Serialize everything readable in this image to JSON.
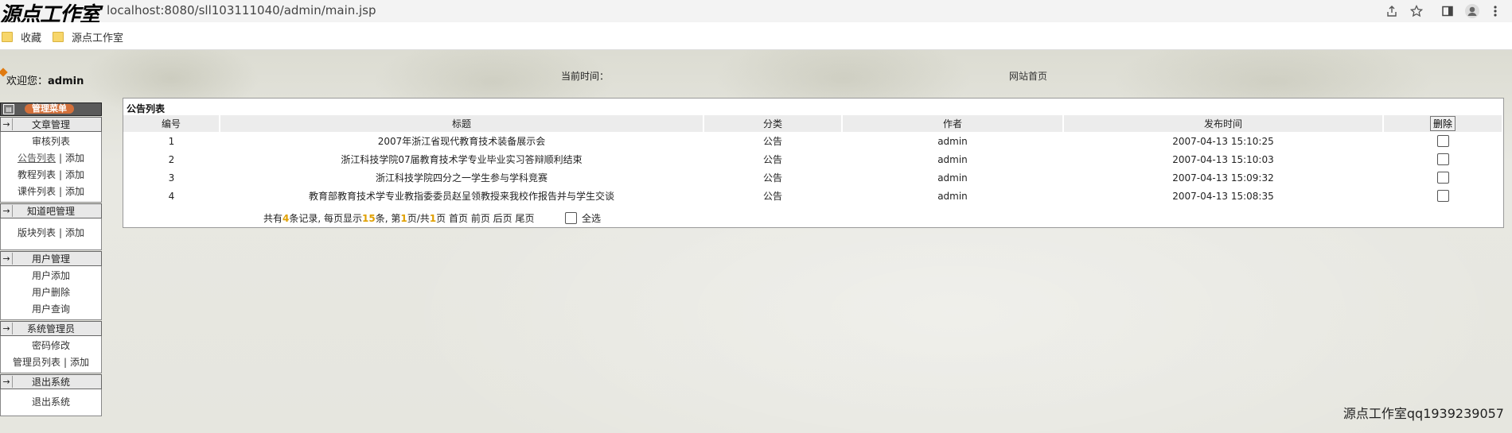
{
  "browser": {
    "url": "localhost:8080/sll103111040/admin/main.jsp",
    "watermark": "源点工作室",
    "bookmarks": [
      "收藏",
      "源点工作室"
    ],
    "icons": [
      "share-icon",
      "star-icon",
      "sidebar-panel-icon",
      "profile-icon",
      "more-menu-icon"
    ]
  },
  "header": {
    "welcome_label": "欢迎您：",
    "username": "admin",
    "current_time_label": "当前时间：",
    "home_link": "网站首页"
  },
  "sidebar": {
    "title": "管理菜单",
    "sections": [
      {
        "label": "文章管理",
        "items": [
          [
            "审核列表"
          ],
          [
            "公告列表",
            "添加"
          ],
          [
            "教程列表",
            "添加"
          ],
          [
            "课件列表",
            "添加"
          ]
        ]
      },
      {
        "label": "知道吧管理",
        "items": [
          [
            "版块列表",
            "添加"
          ]
        ]
      },
      {
        "label": "用户管理",
        "items": [
          [
            "用户添加"
          ],
          [
            "用户删除"
          ],
          [
            "用户查询"
          ]
        ]
      },
      {
        "label": "系统管理员",
        "items": [
          [
            "密码修改"
          ],
          [
            "管理员列表",
            "添加"
          ]
        ]
      },
      {
        "label": "退出系统",
        "items": [
          [
            "退出系统"
          ]
        ]
      }
    ]
  },
  "panel": {
    "title": "公告列表",
    "columns": [
      "编号",
      "标题",
      "分类",
      "作者",
      "发布时间",
      "删除"
    ],
    "rows": [
      {
        "id": "1",
        "title": "2007年浙江省现代教育技术装备展示会",
        "category": "公告",
        "author": "admin",
        "time": "2007-04-13 15:10:25"
      },
      {
        "id": "2",
        "title": "浙江科技学院07届教育技术学专业毕业实习答辩顺利结束",
        "category": "公告",
        "author": "admin",
        "time": "2007-04-13 15:10:03"
      },
      {
        "id": "3",
        "title": "浙江科技学院四分之一学生参与学科竞赛",
        "category": "公告",
        "author": "admin",
        "time": "2007-04-13 15:09:32"
      },
      {
        "id": "4",
        "title": "教育部教育技术学专业教指委委员赵呈领教授来我校作报告并与学生交谈",
        "category": "公告",
        "author": "admin",
        "time": "2007-04-13 15:08:35"
      }
    ],
    "pager": {
      "p1": "共有",
      "total": "4",
      "p2": "条记录, 每页显示",
      "per_page": "15",
      "p3": "条, 第",
      "current": "1",
      "p4": "页/共",
      "pages": "1",
      "p5": "页",
      "first": "首页",
      "prev": "前页",
      "next": "后页",
      "last": "尾页"
    },
    "select_all": "全选"
  },
  "footer": "源点工作室qq1939239057"
}
